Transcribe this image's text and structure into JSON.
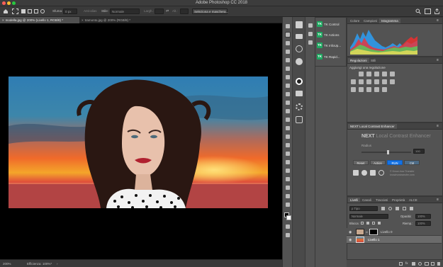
{
  "window": {
    "title": "Adobe Photoshop CC 2018",
    "controls": {
      "close_color": "#ff5f57",
      "minimize_color": "#febc2e",
      "maximize_color": "#28c840"
    }
  },
  "options_bar": {
    "sfuma_label": "Sfuma:",
    "sfuma_value": "0 px",
    "antialias_label": "Anti-alias",
    "stile_label": "Stile:",
    "stile_value": "Normale",
    "largh_label": "Largh.:",
    "alt_label": "Alt.:",
    "select_mask_button": "Seleziona e maschera..."
  },
  "doc_tabs": [
    {
      "label": "modella.jpg @ 200% (Livello 1, RGB/8) *",
      "active": true
    },
    {
      "label": "tramonto.jpg @ 200% (RGB/8) *",
      "active": false
    }
  ],
  "status_bar": {
    "zoom": "200%",
    "info": "Efficienza: 100%*"
  },
  "plugins_panel": {
    "items": [
      {
        "badge": "TK",
        "label": "TK Control"
      },
      {
        "badge": "TK",
        "label": "TK Actions"
      },
      {
        "badge": "TK",
        "label": "TK InfoUp..."
      },
      {
        "badge": "TK",
        "label": "TK Rapid..."
      }
    ]
  },
  "histogram_panel": {
    "tabs": [
      "Colore",
      "Campioni",
      "Istogramma"
    ],
    "active_tab": "Istogramma"
  },
  "adjustments_panel": {
    "tabs": [
      "Regolazioni",
      "Stili"
    ],
    "active_tab": "Regolazioni",
    "add_label": "Aggiungi una regolazione"
  },
  "next_panel": {
    "tab_label": "NEXT Local Contrast Enhancer",
    "brand_bold": "NEXT",
    "brand_rest": "Local Contrast Enhancer",
    "radius_label": "Radius",
    "radius_value": "100",
    "buttons": {
      "reset": "Reset",
      "action": "Action",
      "run": "RUN",
      "cm": "CM"
    },
    "copyright": "© Know-how Transfer",
    "website": "knowhowtransfer.com"
  },
  "layers_panel": {
    "tabs": [
      "Livelli",
      "Canali",
      "Tracciati",
      "Proprietà",
      "ALCE"
    ],
    "active_tab": "Livelli",
    "kind_filter": "ρ Tipo",
    "blend_mode": "Normale",
    "opacity_label": "Opacità:",
    "opacity_value": "100%",
    "lock_label": "Blocca:",
    "fill_label": "Riemp.:",
    "fill_value": "100%",
    "layers": [
      {
        "name": "Livello 0",
        "selected": false
      },
      {
        "name": "Livello 1",
        "selected": true
      }
    ]
  },
  "colors": {
    "accent_blue": "#1473e6",
    "plugin_green": "#1ea860",
    "panel_bg": "#535353",
    "canvas_bg": "#000000"
  }
}
